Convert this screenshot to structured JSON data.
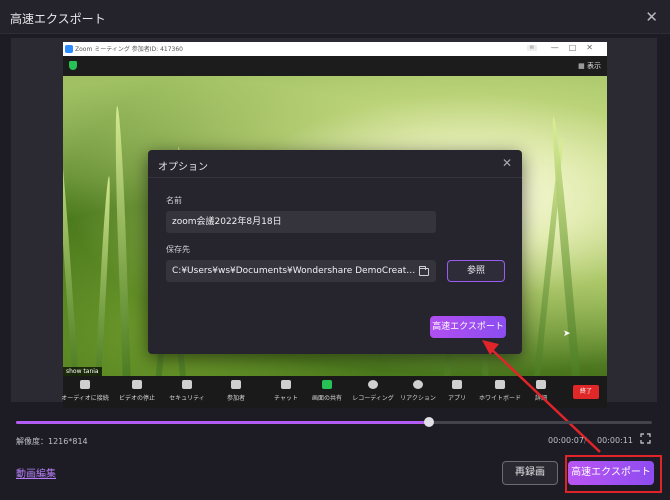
{
  "window": {
    "title": "高速エクスポート",
    "close_glyph": "✕"
  },
  "zoom": {
    "title_text": "Zoom ミーティング 参加者ID: 417360",
    "display_label": "表示",
    "name_tag": "show tania",
    "end_label": "終了",
    "toolbar": [
      {
        "label": "オーディオに接続"
      },
      {
        "label": "ビデオの停止"
      },
      {
        "label": "セキュリティ"
      },
      {
        "label": "参加者"
      },
      {
        "label": "チャット"
      },
      {
        "label": "画面の共有"
      },
      {
        "label": "レコーディング"
      },
      {
        "label": "リアクション"
      },
      {
        "label": "アプリ"
      },
      {
        "label": "ホワイトボード"
      },
      {
        "label": "詳細"
      }
    ]
  },
  "dialog": {
    "title": "オプション",
    "close_glyph": "✕",
    "name_label": "名前",
    "name_value": "zoom会議2022年8月18日",
    "path_label": "保存先",
    "path_value": "C:¥Users¥ws¥Documents¥Wondershare DemoCreator¥E...",
    "browse_label": "参照",
    "export_label": "高速エクスポート"
  },
  "player": {
    "progress": 0.65,
    "resolution": "解像度：1216*814",
    "current_time": "00:00:07",
    "separator": "/",
    "total_time": "00:00:11"
  },
  "footer": {
    "edit_link": "動画編集",
    "rerecord_label": "再録画",
    "export_label": "高速エクスポート"
  },
  "colors": {
    "accent": "#a855f7",
    "highlight": "#e0242a",
    "background": "#1d1c24"
  }
}
